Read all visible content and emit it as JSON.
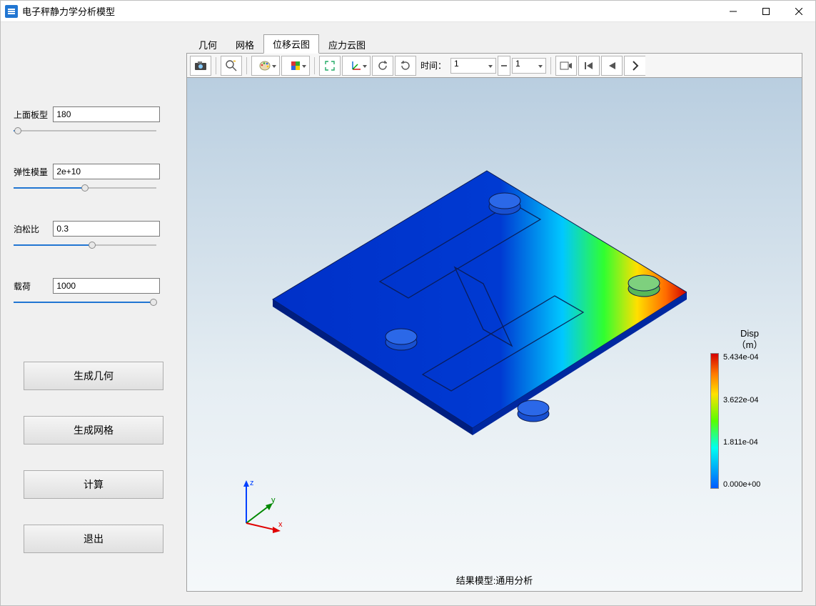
{
  "window": {
    "title": "电子秤静力学分析模型"
  },
  "sidebar": {
    "params": [
      {
        "label": "上面板型",
        "value": "180",
        "slider_pct": 3
      },
      {
        "label": "弹性模量",
        "value": "2e+10",
        "slider_pct": 50
      },
      {
        "label": "泊松比",
        "value": "0.3",
        "slider_pct": 55
      },
      {
        "label": "载荷",
        "value": "1000",
        "slider_pct": 98
      }
    ],
    "buttons": {
      "gen_geom": "生成几何",
      "gen_mesh": "生成网格",
      "compute": "计算",
      "exit": "退出"
    }
  },
  "tabs": {
    "items": [
      "几何",
      "网格",
      "位移云图",
      "应力云图"
    ],
    "active_index": 2
  },
  "toolbar": {
    "time_label": "时间：",
    "time_value": "1",
    "step_value": "1"
  },
  "viewer": {
    "caption": "结果模型:通用分析",
    "axes": {
      "x": "x",
      "y": "y",
      "z": "z"
    },
    "legend": {
      "title_line1": "Disp",
      "title_line2": "（m）",
      "ticks": [
        "5.434e-04",
        "3.622e-04",
        "1.811e-04",
        "0.000e+00"
      ]
    }
  }
}
